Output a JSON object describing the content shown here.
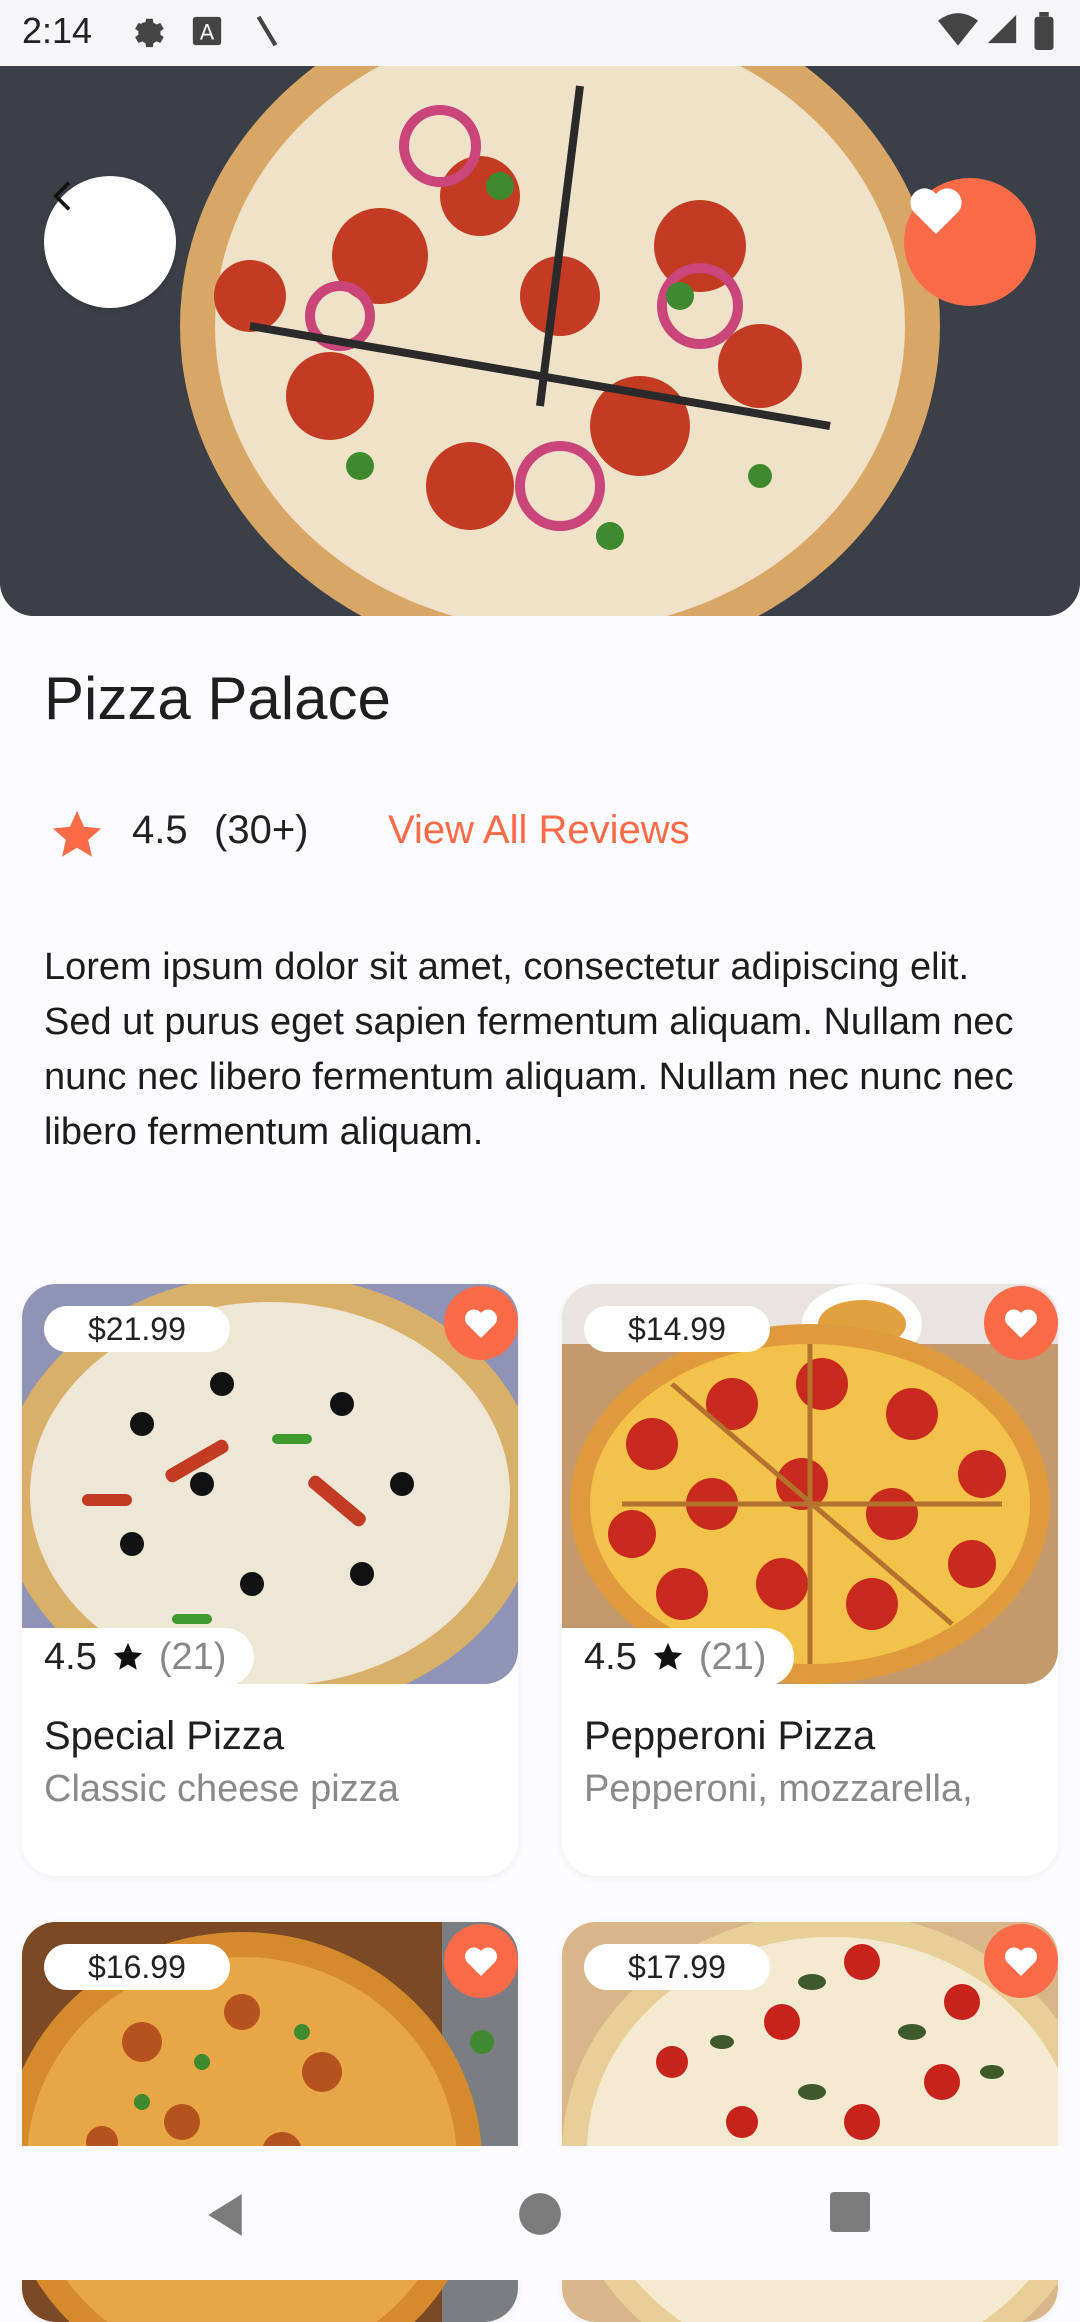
{
  "status_bar": {
    "time": "2:14"
  },
  "restaurant": {
    "name": "Pizza Palace",
    "rating": "4.5",
    "rating_count": "(30+)",
    "reviews_link": "View All Reviews",
    "description": "Lorem ipsum dolor sit amet, consectetur adipiscing elit. Sed ut purus eget sapien fermentum aliquam. Nullam nec nunc nec libero fermentum aliquam. Nullam nec nunc nec libero fermentum aliquam."
  },
  "items": [
    {
      "price": "$21.99",
      "rating": "4.5",
      "count": "(21)",
      "name": "Special Pizza",
      "subtitle": "Classic cheese pizza"
    },
    {
      "price": "$14.99",
      "rating": "4.5",
      "count": "(21)",
      "name": "Pepperoni Pizza",
      "subtitle": "Pepperoni, mozzarella,"
    },
    {
      "price": "$16.99"
    },
    {
      "price": "$17.99"
    }
  ],
  "colors": {
    "accent": "#fb6b48",
    "background": "#fcfbfd"
  },
  "icons": [
    "back-arrow-icon",
    "heart-icon",
    "star-icon",
    "settings-icon",
    "wifi-icon",
    "signal-icon",
    "battery-icon",
    "nav-back-icon",
    "nav-home-icon",
    "nav-recents-icon"
  ]
}
